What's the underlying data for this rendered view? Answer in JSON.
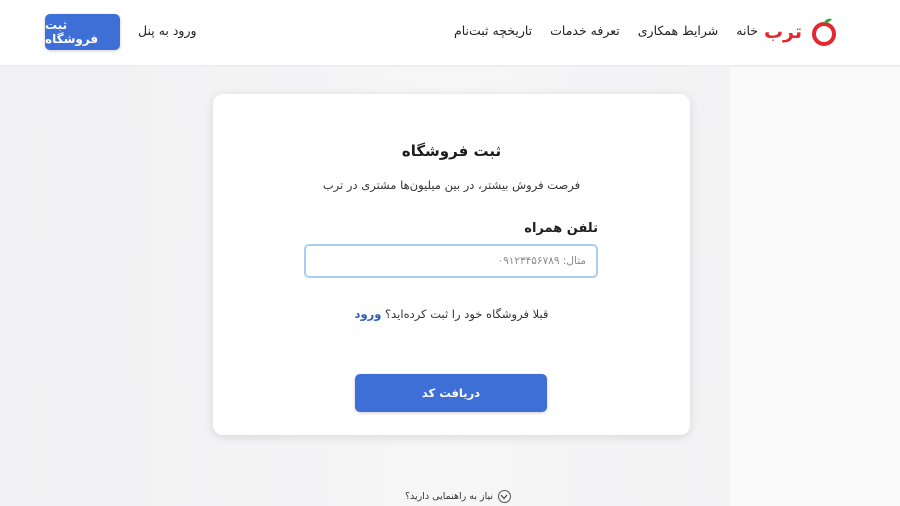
{
  "header": {
    "logo_text": "ترب",
    "nav": [
      "خانه",
      "شرایط همکاری",
      "تعرفه خدمات",
      "تاریخچه ثبت‌نام"
    ],
    "login_label": "ورود به پنل",
    "register_label": "ثبت فروشگاه"
  },
  "card": {
    "title": "ثبت فروشگاه",
    "subtitle": "فرصت فروش بیشتر، در بین میلیون‌ها مشتری در ترب",
    "phone_label": "تلفن همراه",
    "phone_placeholder": "مثال: ۰۹۱۲۳۴۵۶۷۸۹",
    "already_text": "قبلا فروشگاه خود را ثبت کرده‌اید؟",
    "already_link": "ورود",
    "submit_label": "دریافت کد"
  },
  "help_text": "نیاز به راهنمایی دارید؟",
  "colors": {
    "brand_red": "#e3282f",
    "primary_blue": "#3e6fd6",
    "link_blue": "#2b5db8",
    "input_border": "#a9cff0"
  }
}
